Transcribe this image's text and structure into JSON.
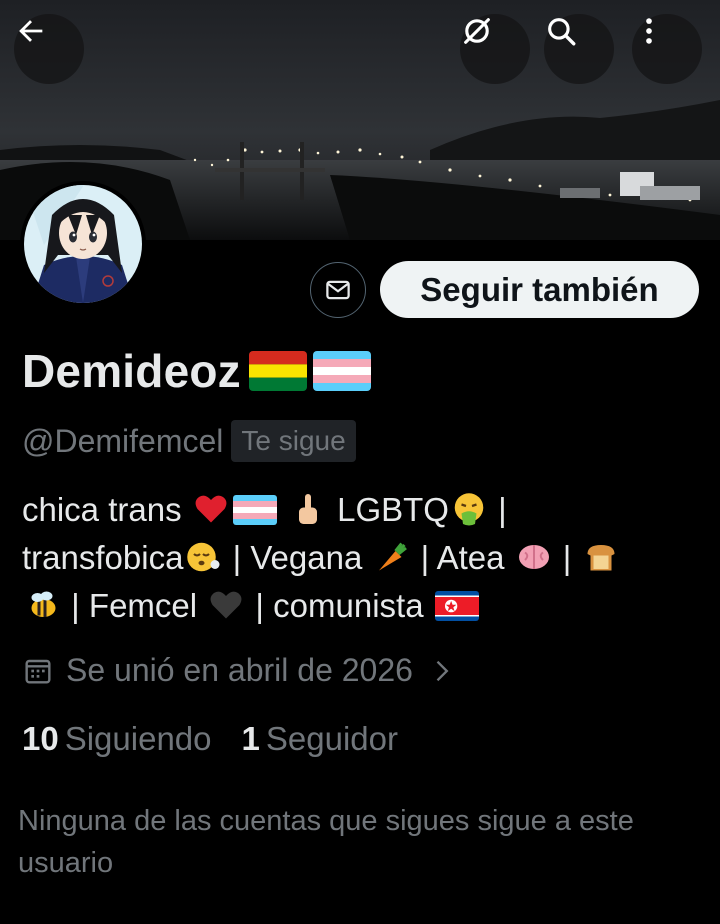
{
  "header": {
    "back_icon": "arrow-left-icon",
    "grok_icon": "grok-icon",
    "search_icon": "search-icon",
    "more_icon": "more-vertical-icon"
  },
  "profile": {
    "display_name": "Demideoz",
    "name_flags": [
      "bolivia-flag-emoji",
      "transgender-flag-emoji"
    ],
    "handle": "@Demifemcel",
    "follows_you_badge": "Te sigue",
    "follow_button_label": "Seguir también",
    "message_icon": "envelope-icon"
  },
  "bio": {
    "seg1": "chica trans ",
    "seg2": " LGBTQ",
    "seg3": " |",
    "seg4": "transfobica",
    "seg5": " | Vegana ",
    "seg6": " | Atea ",
    "seg7": " | ",
    "seg8": " | Femcel ",
    "seg9": " | comunista "
  },
  "joined": {
    "icon": "calendar-icon",
    "text": "Se unió en abril de 2026",
    "chevron": "chevron-right-icon"
  },
  "stats": {
    "following_count": "10",
    "following_label": "Siguiendo",
    "followers_count": "1",
    "followers_label": "Seguidor"
  },
  "mutuals_text": "Ninguna de las cuentas que sigues sigue a este usuario",
  "colors": {
    "background": "#000000",
    "text_primary": "#e7e9ea",
    "text_secondary": "#71767b",
    "follow_button_bg": "#eff3f4",
    "border": "#536471"
  }
}
